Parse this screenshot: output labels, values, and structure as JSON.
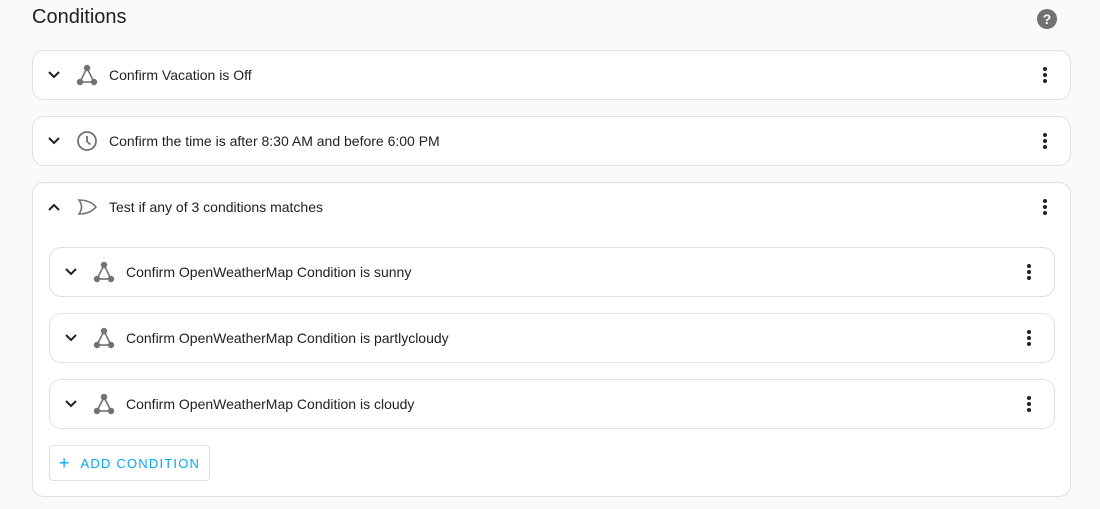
{
  "header": {
    "title": "Conditions",
    "help_icon": "help-circle-icon"
  },
  "conditions": [
    {
      "label": "Confirm Vacation is Off",
      "icon": "state-icon",
      "expanded": false
    },
    {
      "label": "Confirm the time is after 8:30 AM and before 6:00 PM",
      "icon": "clock-icon",
      "expanded": false
    },
    {
      "label": "Test if any of 3 conditions matches",
      "icon": "or-gate-icon",
      "expanded": true,
      "children": [
        {
          "label": "Confirm OpenWeatherMap Condition is sunny",
          "icon": "state-icon",
          "expanded": false
        },
        {
          "label": "Confirm OpenWeatherMap Condition is partlycloudy",
          "icon": "state-icon",
          "expanded": false
        },
        {
          "label": "Confirm OpenWeatherMap Condition is cloudy",
          "icon": "state-icon",
          "expanded": false
        }
      ],
      "add_button": {
        "icon": "+",
        "label": "ADD CONDITION"
      }
    }
  ],
  "colors": {
    "accent": "#03a9f4",
    "icon": "#727272",
    "border": "#e0e0e0",
    "background": "#fafafa"
  }
}
